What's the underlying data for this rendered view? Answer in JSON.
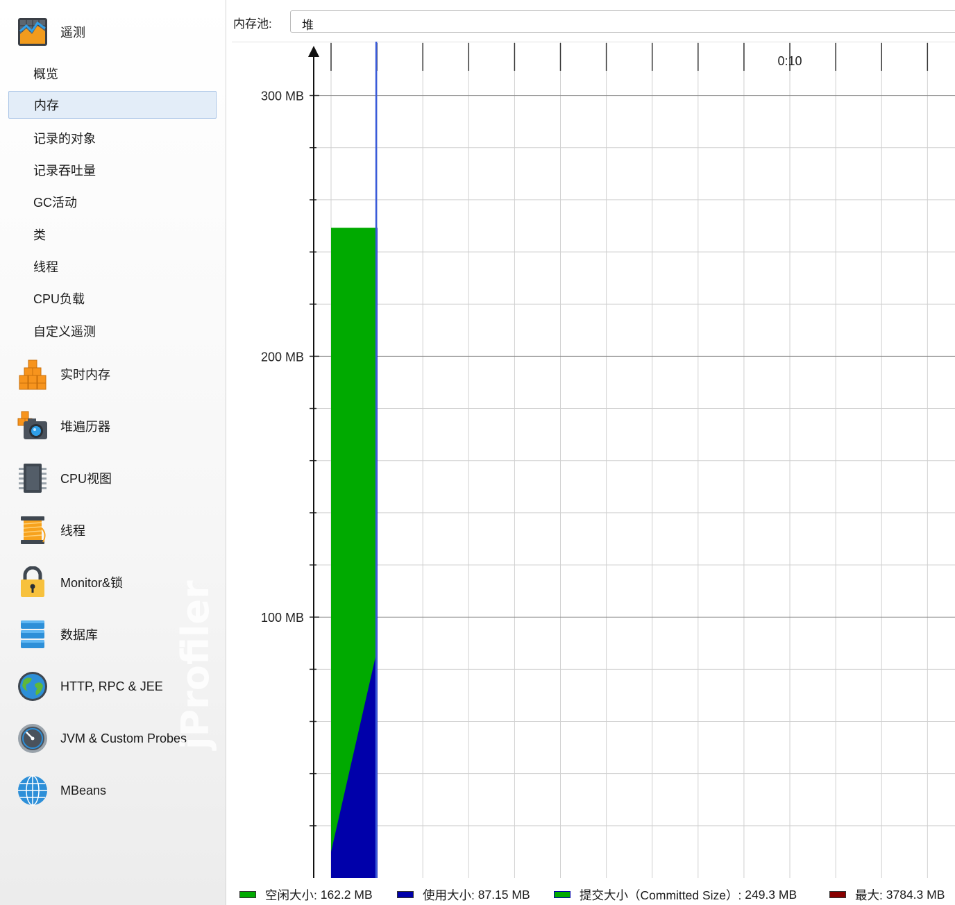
{
  "sidebar": {
    "telemetry": {
      "label": "遥测",
      "icon": "telemetry-chart-icon"
    },
    "telemetry_items": [
      {
        "label": "概览",
        "selected": false
      },
      {
        "label": "内存",
        "selected": true
      },
      {
        "label": "记录的对象",
        "selected": false
      },
      {
        "label": "记录吞吐量",
        "selected": false
      },
      {
        "label": "GC活动",
        "selected": false
      },
      {
        "label": "类",
        "selected": false
      },
      {
        "label": "线程",
        "selected": false
      },
      {
        "label": "CPU负载",
        "selected": false
      },
      {
        "label": "自定义遥测",
        "selected": false
      }
    ],
    "sections": [
      {
        "label": "实时内存",
        "icon": "live-memory-cubes-icon"
      },
      {
        "label": "堆遍历器",
        "icon": "heap-walker-camera-icon"
      },
      {
        "label": "CPU视图",
        "icon": "cpu-chip-icon"
      },
      {
        "label": "线程",
        "icon": "threads-spool-icon"
      },
      {
        "label": "Monitor&锁",
        "icon": "lock-icon"
      },
      {
        "label": "数据库",
        "icon": "database-icon"
      },
      {
        "label": "HTTP, RPC & JEE",
        "icon": "globe-earth-icon"
      },
      {
        "label": "JVM & Custom Probes",
        "icon": "gauge-probe-icon"
      },
      {
        "label": "MBeans",
        "icon": "mbeans-globe-icon"
      }
    ],
    "watermark": "jProfiler"
  },
  "toolbar": {
    "pool_label": "内存池:",
    "pool_value": "堆"
  },
  "colors": {
    "free": "#00aa00",
    "used": "#0000aa",
    "committed": "#00aa00",
    "max": "#880000",
    "time_marker": "#3a5bd9",
    "selection_bg": "#e3edf8"
  },
  "chart_data": {
    "type": "area",
    "y_unit": "MB",
    "ylim": [
      0,
      320
    ],
    "y_ticks": [
      100,
      200,
      300
    ],
    "y_tick_labels": [
      "100 MB",
      "200 MB",
      "300 MB"
    ],
    "x_unit": "seconds",
    "xlim": [
      0,
      13.6
    ],
    "x_tick_labels": [
      {
        "t": 10,
        "label": "0:10"
      }
    ],
    "grid": true,
    "series": [
      {
        "name": "空闲大小",
        "key": "free",
        "x": [
          0,
          1
        ],
        "values": [
          162.2,
          162.2
        ],
        "stacked_on": "used"
      },
      {
        "name": "使用大小",
        "key": "used",
        "x": [
          0,
          1
        ],
        "values": [
          10,
          87.15
        ]
      },
      {
        "name": "提交大小（Committed Size）",
        "key": "committed",
        "x": [
          0,
          1
        ],
        "values": [
          249.3,
          249.3
        ]
      }
    ],
    "time_marker": 1.0,
    "legend": [
      {
        "key": "free",
        "label": "空闲大小:",
        "value": "162.2 MB"
      },
      {
        "key": "used",
        "label": "使用大小:",
        "value": "87.15 MB"
      },
      {
        "key": "committed",
        "label": "提交大小（Committed Size）:",
        "value": "249.3 MB"
      },
      {
        "key": "max",
        "label": "最大:",
        "value": "3784.3 MB"
      }
    ],
    "legend_placement": "bottom"
  }
}
